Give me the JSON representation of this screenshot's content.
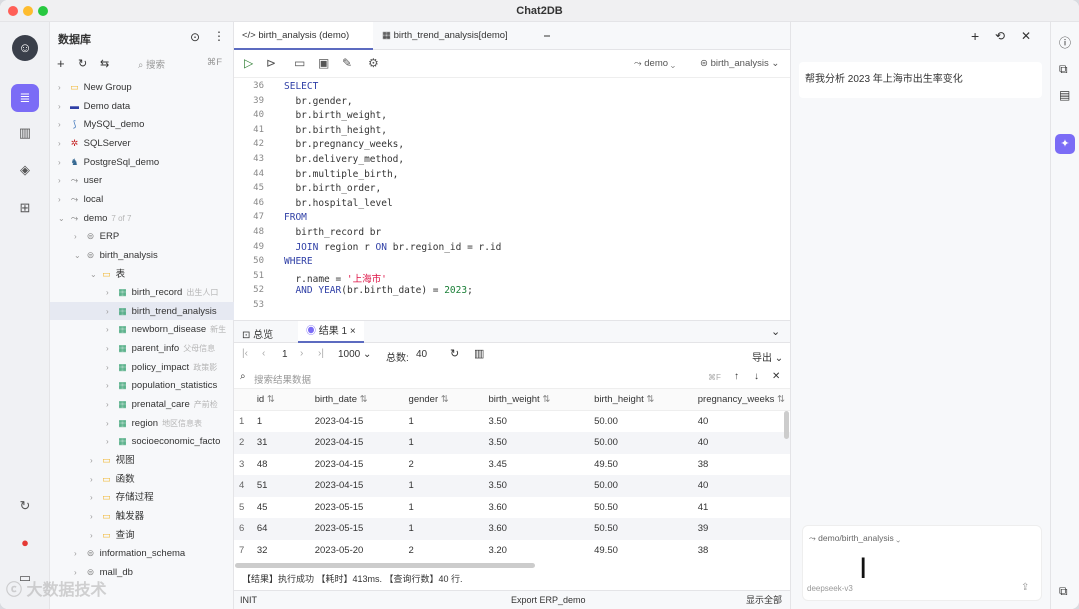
{
  "app": {
    "title": "Chat2DB"
  },
  "sidebar": {
    "header": "数据库",
    "search_placeholder": "搜索",
    "search_shortcut": "⌘F",
    "items": [
      {
        "label": "New Group",
        "hint": ""
      },
      {
        "label": "Demo data",
        "hint": ""
      },
      {
        "label": "MySQL_demo",
        "hint": ""
      },
      {
        "label": "SQLServer",
        "hint": ""
      },
      {
        "label": "PostgreSql_demo",
        "hint": ""
      },
      {
        "label": "user",
        "hint": ""
      },
      {
        "label": "local",
        "hint": ""
      },
      {
        "label": "demo",
        "hint": "7 of 7"
      },
      {
        "label": "ERP",
        "hint": ""
      },
      {
        "label": "birth_analysis",
        "hint": ""
      },
      {
        "label": "表",
        "hint": ""
      },
      {
        "label": "birth_record",
        "hint": "出生人口"
      },
      {
        "label": "birth_trend_analysis",
        "hint": ""
      },
      {
        "label": "newborn_disease",
        "hint": "新生"
      },
      {
        "label": "parent_info",
        "hint": "父母信息"
      },
      {
        "label": "policy_impact",
        "hint": "政策影"
      },
      {
        "label": "population_statistics",
        "hint": ""
      },
      {
        "label": "prenatal_care",
        "hint": "产前检"
      },
      {
        "label": "region",
        "hint": "地区信息表"
      },
      {
        "label": "socioeconomic_facto",
        "hint": ""
      },
      {
        "label": "视图",
        "hint": ""
      },
      {
        "label": "函数",
        "hint": ""
      },
      {
        "label": "存储过程",
        "hint": ""
      },
      {
        "label": "触发器",
        "hint": ""
      },
      {
        "label": "查询",
        "hint": ""
      },
      {
        "label": "information_schema",
        "hint": ""
      },
      {
        "label": "mall_db",
        "hint": ""
      }
    ]
  },
  "tabs": [
    {
      "label": "</> birth_analysis (demo)"
    },
    {
      "label": "birth_trend_analysis[demo]"
    }
  ],
  "toolbar": {
    "db": "demo",
    "schema": "birth_analysis"
  },
  "editor": {
    "lines": [
      {
        "n": "36",
        "text": "SELECT"
      },
      {
        "n": "39",
        "text": "  br.gender,"
      },
      {
        "n": "40",
        "text": "  br.birth_weight,"
      },
      {
        "n": "41",
        "text": "  br.birth_height,"
      },
      {
        "n": "42",
        "text": "  br.pregnancy_weeks,"
      },
      {
        "n": "43",
        "text": "  br.delivery_method,"
      },
      {
        "n": "44",
        "text": "  br.multiple_birth,"
      },
      {
        "n": "45",
        "text": "  br.birth_order,"
      },
      {
        "n": "46",
        "text": "  br.hospital_level"
      },
      {
        "n": "47",
        "text": "FROM"
      },
      {
        "n": "48",
        "text": "  birth_record br"
      },
      {
        "n": "49",
        "text": "  JOIN region r ON br.region_id = r.id"
      },
      {
        "n": "50",
        "text": "WHERE"
      },
      {
        "n": "51",
        "text": "  r.name = '上海市'"
      },
      {
        "n": "52",
        "text": "  AND YEAR(br.birth_date) = 2023;"
      },
      {
        "n": "53",
        "text": ""
      }
    ]
  },
  "results": {
    "tab_overview": "总览",
    "tab_result": "结果 1",
    "page": "1",
    "page_size": "1000",
    "total_label": "总数:",
    "total": "40",
    "export": "导出",
    "search_placeholder": "搜索结果数据",
    "columns": [
      "id",
      "birth_date",
      "gender",
      "birth_weight",
      "birth_height",
      "pregnancy_weeks"
    ],
    "rows": [
      {
        "idx": "1",
        "cells": [
          "1",
          "2023-04-15",
          "1",
          "3.50",
          "50.00",
          "40"
        ]
      },
      {
        "idx": "2",
        "cells": [
          "31",
          "2023-04-15",
          "1",
          "3.50",
          "50.00",
          "40"
        ]
      },
      {
        "idx": "3",
        "cells": [
          "48",
          "2023-04-15",
          "2",
          "3.45",
          "49.50",
          "38"
        ]
      },
      {
        "idx": "4",
        "cells": [
          "51",
          "2023-04-15",
          "1",
          "3.50",
          "50.00",
          "40"
        ]
      },
      {
        "idx": "5",
        "cells": [
          "45",
          "2023-05-15",
          "1",
          "3.60",
          "50.50",
          "41"
        ]
      },
      {
        "idx": "6",
        "cells": [
          "64",
          "2023-05-15",
          "1",
          "3.60",
          "50.50",
          "39"
        ]
      },
      {
        "idx": "7",
        "cells": [
          "32",
          "2023-05-20",
          "2",
          "3.20",
          "49.50",
          "38"
        ]
      }
    ],
    "status_line": "【结果】执行成功  【耗时】413ms.  【查询行数】40 行.",
    "footer_left": "INIT",
    "footer_mid": "Export ERP_demo",
    "footer_right": "显示全部"
  },
  "chat": {
    "message": "帮我分析 2023 年上海市出生率变化",
    "context": "demo/birth_analysis",
    "model": "deepseek-v3"
  },
  "watermark": "大数据技术"
}
